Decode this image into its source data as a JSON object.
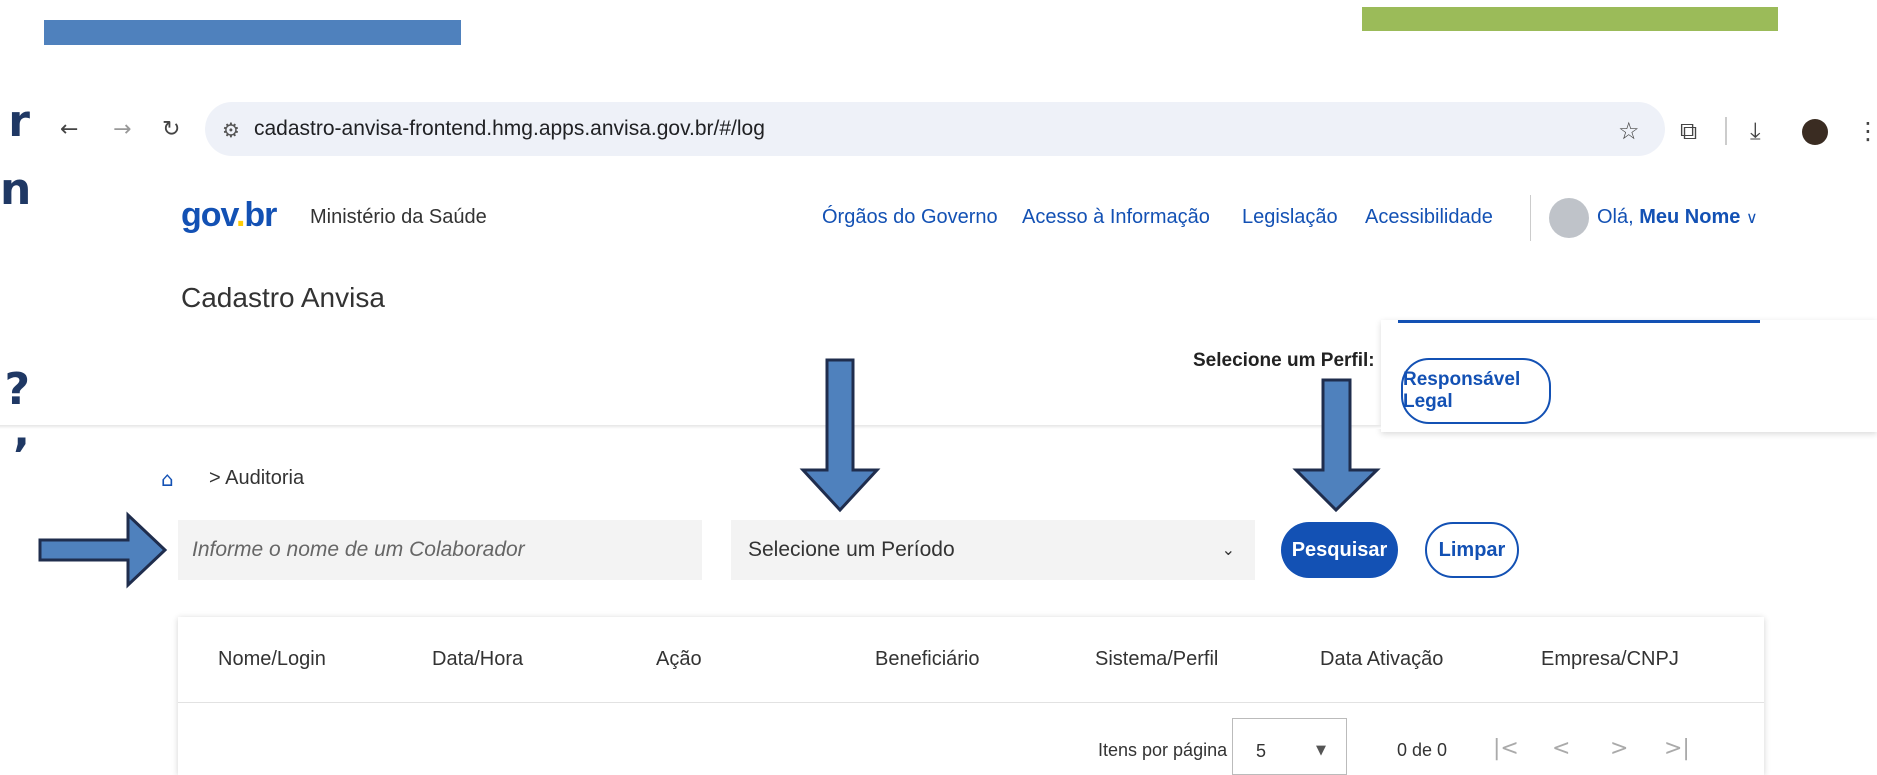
{
  "colors": {
    "gov_blue": "#1351b4",
    "gov_yellow": "#ffcd07",
    "deco_blue": "#4f81bd",
    "deco_green": "#9bbb59",
    "arrow_fill": "#4f81bd",
    "arrow_stroke": "#1f2d4d"
  },
  "browser": {
    "back_icon": "arrow-left-icon",
    "forward_icon": "arrow-right-icon",
    "reload_icon": "reload-icon",
    "url": "cadastro-anvisa-frontend.hmg.apps.anvisa.gov.br/#/log",
    "star_icon": "star-icon",
    "extensions_icon": "puzzle-icon",
    "download_icon": "download-icon",
    "menu_icon": "kebab-menu-icon"
  },
  "side_fragments": [
    "r",
    "n",
    "?",
    ","
  ],
  "header": {
    "logo_part1": "gov",
    "logo_part2": ".",
    "logo_part3": "br",
    "ministry": "Ministério da Saúde",
    "links": [
      "Órgãos do Governo",
      "Acesso à Informação",
      "Legislação",
      "Acessibilidade"
    ],
    "greeting_prefix": "Olá, ",
    "greeting_name": "Meu Nome",
    "app_title": "Cadastro Anvisa"
  },
  "perfil": {
    "label": "Selecione um Perfil:",
    "option": "Responsável Legal"
  },
  "breadcrumb": {
    "separator": ">",
    "current": "Auditoria"
  },
  "filters": {
    "colaborador_placeholder": "Informe o nome de um Colaborador",
    "periodo_value": "Selecione um Período",
    "search_label": "Pesquisar",
    "clear_label": "Limpar"
  },
  "table": {
    "columns": [
      "Nome/Login",
      "Data/Hora",
      "Ação",
      "Beneficiário",
      "Sistema/Perfil",
      "Data Ativação",
      "Empresa/CNPJ"
    ],
    "rows": []
  },
  "pagination": {
    "items_per_page_label": "Itens por página",
    "items_per_page": "5",
    "range": "0 de 0"
  }
}
